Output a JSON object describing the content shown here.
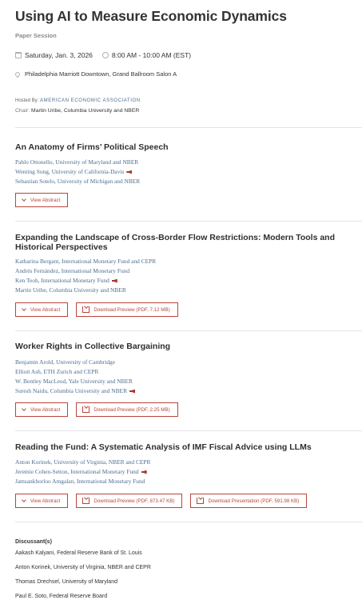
{
  "session": {
    "title": "Using AI to Measure Economic Dynamics",
    "type": "Paper Session",
    "date": "Saturday, Jan. 3, 2026",
    "time": "8:00 AM - 10:00 AM (EST)",
    "location": "Philadelphia Marriott Downtown, Grand Ballroom Salon A",
    "hosted_label": "Hosted By:",
    "hosted_org": "AMERICAN ECONOMIC ASSOCIATION",
    "chair_label": "Chair:",
    "chair": "Martin Uribe, Columbia University and NBER"
  },
  "icons": {
    "date": "calendar-icon",
    "time": "clock-icon",
    "location": "map-pin-icon",
    "presenter": "megaphone-icon",
    "view_abstract": "chevron-down-icon",
    "download": "download-icon"
  },
  "colors": {
    "accent": "#b8463a",
    "author_link": "#4c6e91",
    "title": "#333333",
    "divider": "#e4e4e4"
  },
  "papers": [
    {
      "title": "An Anatomy of Firms’ Political Speech",
      "authors": [
        {
          "name": "Pablo Ottonello, University of Maryland and NBER",
          "presenter": false
        },
        {
          "name": "Wenting Song, University of California-Davis",
          "presenter": true
        },
        {
          "name": "Sebastian Sotelo, University of Michigan and NBER",
          "presenter": false
        }
      ],
      "buttons": [
        "View Abstract"
      ]
    },
    {
      "title": "Expanding the Landscape of Cross-Border Flow Restrictions: Modern Tools and Historical Perspectives",
      "authors": [
        {
          "name": "Katharina Bergant, International Monetary Fund and CEPR",
          "presenter": false
        },
        {
          "name": "Andrés Fernández, International Monetary Fund",
          "presenter": false
        },
        {
          "name": "Ken Teoh, International Monetary Fund",
          "presenter": true
        },
        {
          "name": "Martin Uribe, Columbia University and NBER",
          "presenter": false
        }
      ],
      "buttons": [
        "View Abstract",
        "Download Preview (PDF, 7.12 MB)"
      ]
    },
    {
      "title": "Worker Rights in Collective Bargaining",
      "authors": [
        {
          "name": "Benjamin Arold, University of Cambridge",
          "presenter": false
        },
        {
          "name": "Elliott Ash, ETH Zurich and CEPR",
          "presenter": false
        },
        {
          "name": "W. Bentley MacLeod, Yale University and NBER",
          "presenter": false
        },
        {
          "name": "Suresh Naidu, Columbia University and NBER",
          "presenter": true
        }
      ],
      "buttons": [
        "View Abstract",
        "Download Preview (PDF, 2.25 MB)"
      ]
    },
    {
      "title": "Reading the Fund: A Systematic Analysis of IMF Fiscal Advice using LLMs",
      "authors": [
        {
          "name": "Anton Korinek, University of Virginia, NBER and CEPR",
          "presenter": false
        },
        {
          "name": "Jeremie Cohen-Setton, International Monetary Fund",
          "presenter": true
        },
        {
          "name": "Jamsankhorloo Amgalan, International Monetary Fund",
          "presenter": false
        }
      ],
      "buttons": [
        "View Abstract",
        "Download Preview (PDF, 873.47 KB)",
        "Download Presentation (PDF, 591.98 KB)"
      ]
    }
  ],
  "discussants": {
    "label": "Discussant(s)",
    "items": [
      "Aakash Kalyani, Federal Reserve Bank of St. Louis",
      "Anton Korinek, University of Virginia, NBER and CEPR",
      "Thomas Drechsel, University of Maryland",
      "Paul E. Soto, Federal Reserve Board"
    ]
  }
}
